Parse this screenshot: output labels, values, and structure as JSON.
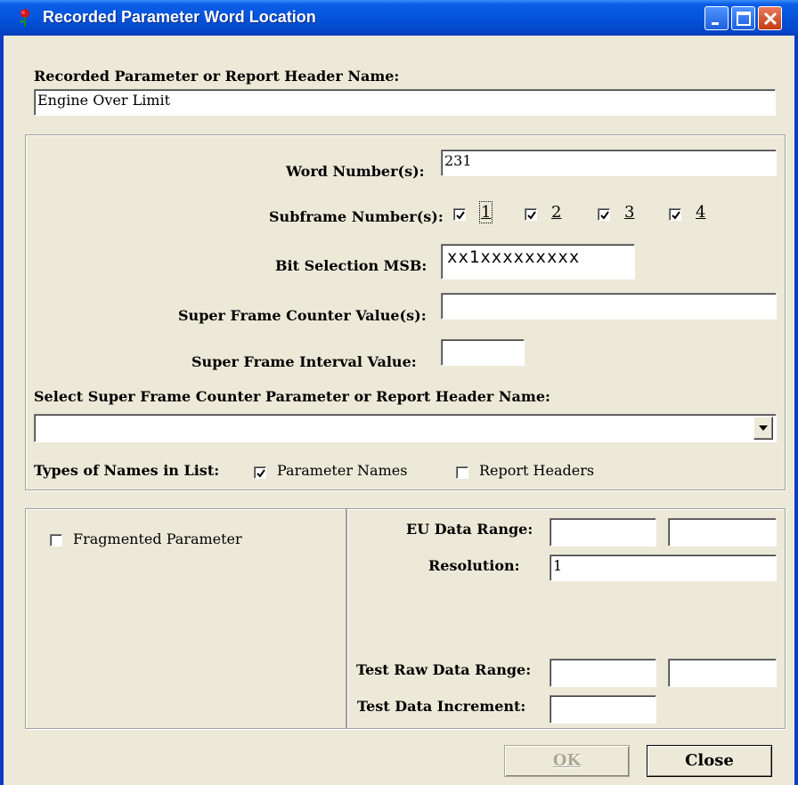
{
  "window": {
    "title": "Recorded Parameter Word Location"
  },
  "header": {
    "name_label": "Recorded Parameter or Report Header Name:",
    "name_value": "Engine Over Limit"
  },
  "location": {
    "word_numbers_label": "Word Number(s):",
    "word_numbers_value": "231",
    "subframe_label": "Subframe Number(s):",
    "subframes": [
      {
        "label": "1",
        "checked": true
      },
      {
        "label": "2",
        "checked": true
      },
      {
        "label": "3",
        "checked": true
      },
      {
        "label": "4",
        "checked": true
      }
    ],
    "bit_msb_label": "Bit Selection MSB:",
    "bit_msb_value": "xx1xxxxxxxxx",
    "sf_counter_label": "Super Frame Counter Value(s):",
    "sf_counter_value": "",
    "sf_interval_label": "Super Frame Interval Value:",
    "sf_interval_value": "",
    "select_label": "Select Super Frame Counter Parameter or Report Header Name:",
    "select_value": "",
    "types_label": "Types of Names in List:",
    "param_names_label": "Parameter Names",
    "param_names_checked": true,
    "report_headers_label": "Report Headers",
    "report_headers_checked": false
  },
  "fragment": {
    "label": "Fragmented Parameter",
    "checked": false
  },
  "ranges": {
    "eu_label": "EU Data Range:",
    "eu_min": "",
    "eu_max": "",
    "resolution_label": "Resolution:",
    "resolution_value": "1",
    "test_raw_label": "Test Raw Data Range:",
    "test_raw_min": "",
    "test_raw_max": "",
    "test_inc_label": "Test Data Increment:",
    "test_inc_value": ""
  },
  "buttons": {
    "ok": "OK",
    "close": "Close"
  },
  "colors": {
    "title_bar": "#0553dc",
    "dialog_bg": "#ece9d8",
    "disabled_text": "#aca899"
  }
}
